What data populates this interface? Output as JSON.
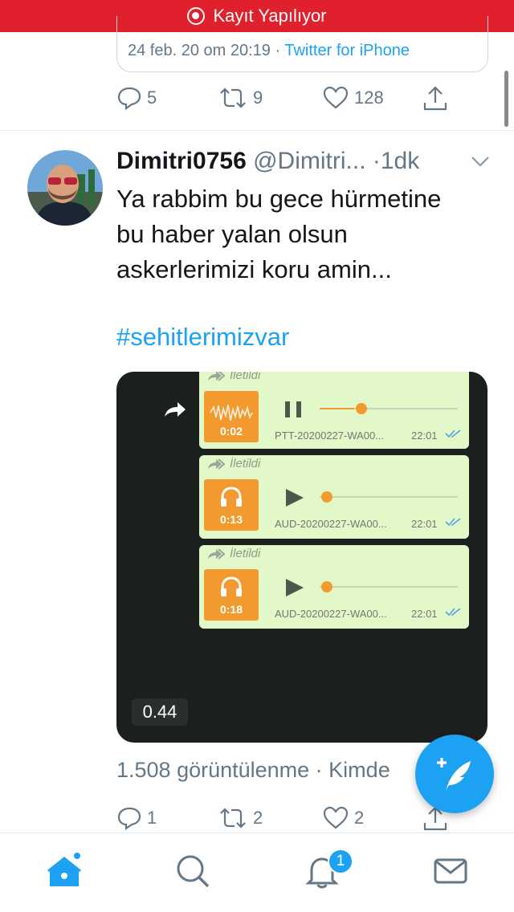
{
  "status_bar": {
    "recording_label": "Kayıt Yapılıyor"
  },
  "quoted_tweet": {
    "date": "24 feb. 20 om 20:19",
    "separator": "·",
    "source": "Twitter for iPhone",
    "actions": {
      "reply_count": "5",
      "retweet_count": "9",
      "like_count": "128"
    }
  },
  "tweet": {
    "display_name": "Dimitri0756",
    "handle": "@Dimitri...",
    "time": "·1dk",
    "text_lines": [
      "Ya rabbim bu gece hürmetine",
      "bu haber yalan olsun",
      "askerlerimizi koru amin..."
    ],
    "hashtag": "#sehitlerimizvar",
    "video": {
      "duration_label": "0.44",
      "messages": [
        {
          "forwarded_label": "İletildi",
          "tile_duration": "0:02",
          "file_name": "PTT-20200227-WA00...",
          "time": "22:01",
          "state": "playing",
          "progress": 0.25
        },
        {
          "forwarded_label": "İletildi",
          "tile_duration": "0:13",
          "file_name": "AUD-20200227-WA00...",
          "time": "22:01",
          "state": "paused",
          "progress": 0.0
        },
        {
          "forwarded_label": "İletildi",
          "tile_duration": "0:18",
          "file_name": "AUD-20200227-WA00...",
          "time": "22:01",
          "state": "paused",
          "progress": 0.0
        }
      ]
    },
    "views_label": "1.508 görüntülenme · Kimde",
    "actions": {
      "reply_count": "1",
      "retweet_count": "2",
      "like_count": "2"
    }
  },
  "tabbar": {
    "items": [
      "home-icon",
      "search-icon",
      "notifications-icon",
      "messages-icon"
    ],
    "notifications_badge": "1"
  },
  "colors": {
    "accent": "#1da1f2",
    "recording": "#e0202c",
    "voice_tile": "#f29a2e",
    "voice_bubble": "#e3f8c8"
  }
}
